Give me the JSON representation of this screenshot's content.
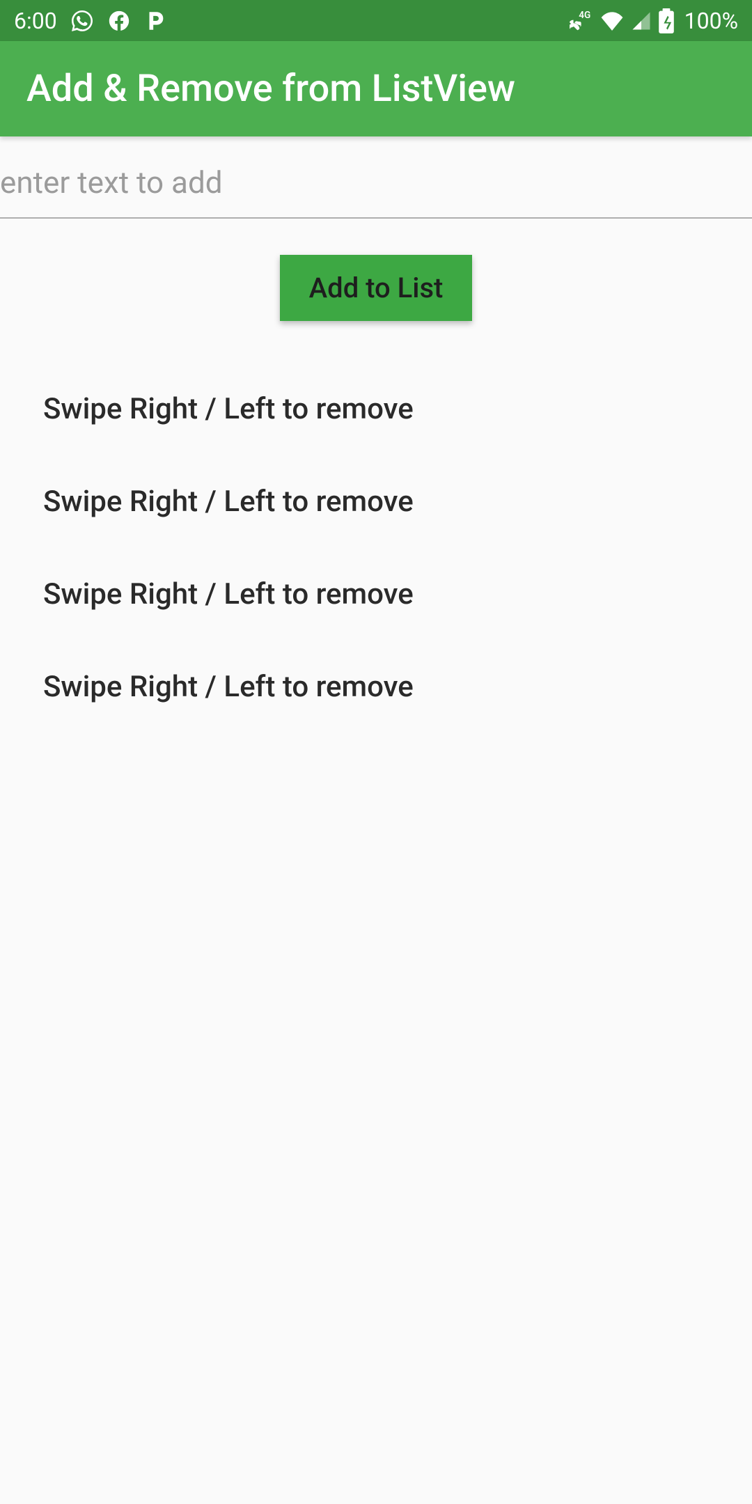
{
  "statusBar": {
    "time": "6:00",
    "batteryText": "100%",
    "icons": {
      "whatsapp": "whatsapp-icon",
      "facebook": "facebook-icon",
      "pandora": "pandora-icon",
      "phone4g": "phone-4g-icon",
      "wifi": "wifi-icon",
      "signal": "signal-icon",
      "battery": "battery-charging-icon"
    }
  },
  "appBar": {
    "title": "Add & Remove from ListView"
  },
  "input": {
    "placeholder": "enter text to add",
    "value": ""
  },
  "button": {
    "label": "Add to List"
  },
  "listItems": [
    {
      "text": "Swipe Right / Left to remove"
    },
    {
      "text": "Swipe Right / Left to remove"
    },
    {
      "text": "Swipe Right / Left to remove"
    },
    {
      "text": "Swipe Right / Left to remove"
    }
  ]
}
